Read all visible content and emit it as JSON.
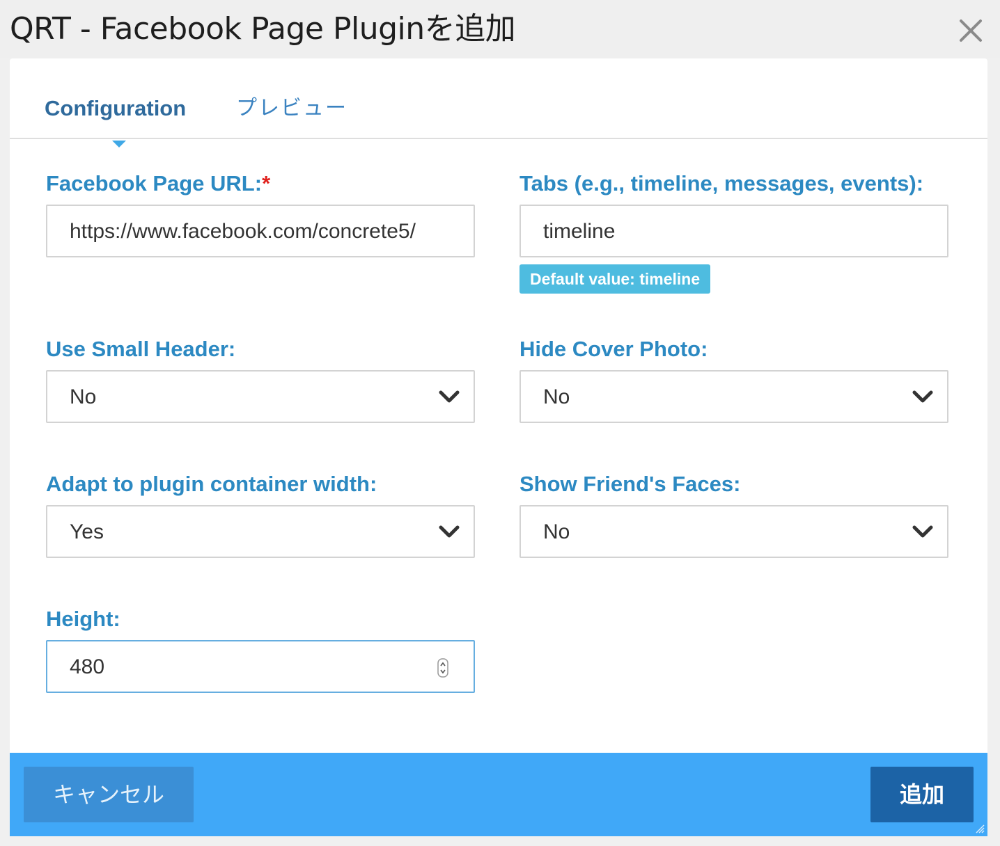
{
  "dialog": {
    "title": "QRT - Facebook Page Pluginを追加"
  },
  "tabs": [
    {
      "label": "Configuration",
      "active": true
    },
    {
      "label": "プレビュー",
      "active": false
    }
  ],
  "form": {
    "page_url": {
      "label": "Facebook Page URL:",
      "required_marker": "*",
      "value": "https://www.facebook.com/concrete5/"
    },
    "tabs_field": {
      "label": "Tabs (e.g., timeline, messages, events):",
      "value": "timeline",
      "hint": "Default value: timeline"
    },
    "small_header": {
      "label": "Use Small Header:",
      "selected": "No"
    },
    "hide_cover": {
      "label": "Hide Cover Photo:",
      "selected": "No"
    },
    "adapt_width": {
      "label": "Adapt to plugin container width:",
      "selected": "Yes"
    },
    "show_faces": {
      "label": "Show Friend's Faces:",
      "selected": "No"
    },
    "height": {
      "label": "Height:",
      "value": "480"
    }
  },
  "footer": {
    "cancel_label": "キャンセル",
    "add_label": "追加"
  },
  "colors": {
    "label": "#2c89c2",
    "footer_bg": "#40a8f8",
    "add_button": "#1c63a6",
    "cancel_button": "#3b8fd6",
    "hint_badge": "#4ebce0",
    "required": "#e0201c"
  }
}
